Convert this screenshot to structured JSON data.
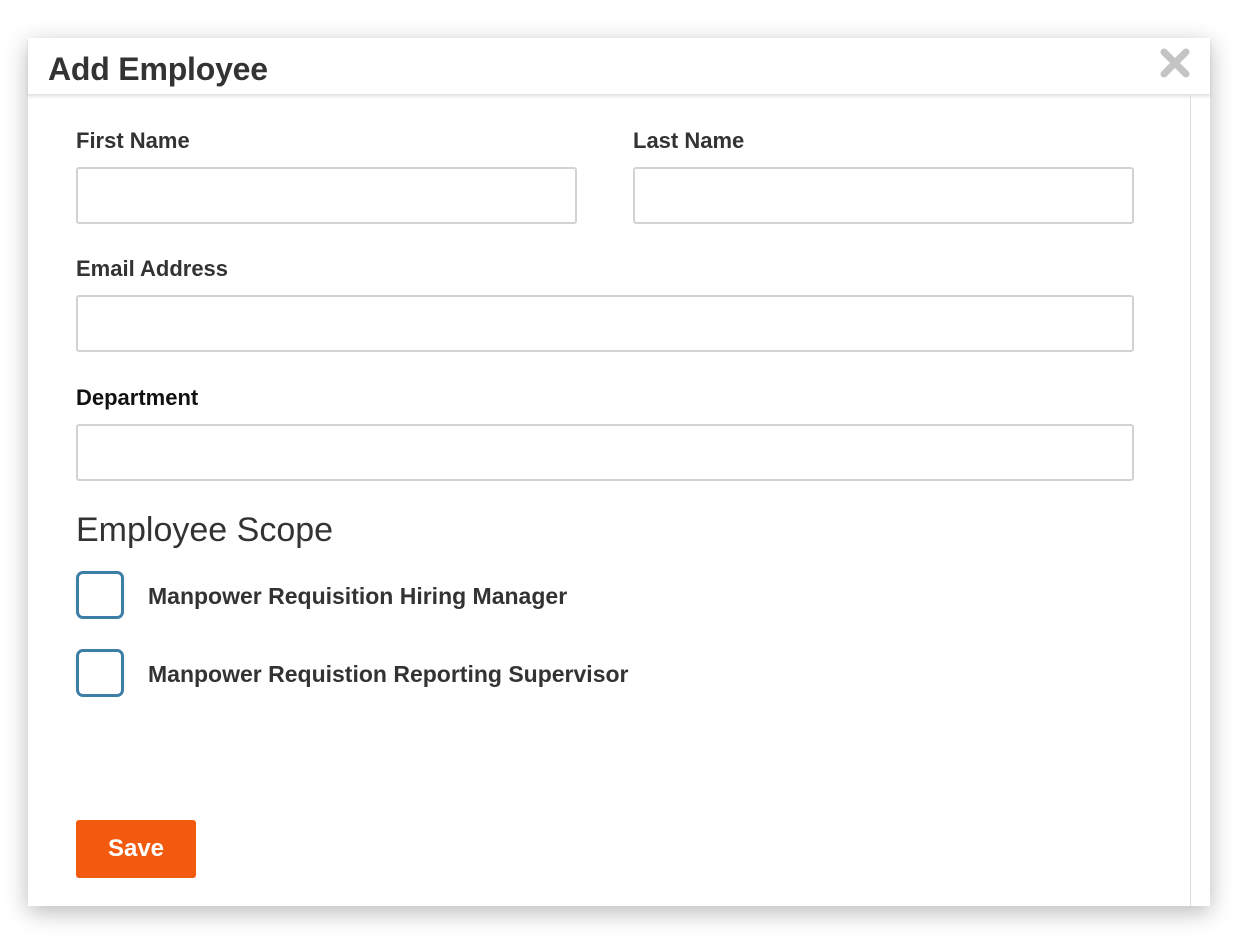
{
  "dialog": {
    "title": "Add Employee",
    "close_icon": "close-icon"
  },
  "form": {
    "first_name": {
      "label": "First Name",
      "value": "",
      "placeholder": ""
    },
    "last_name": {
      "label": "Last Name",
      "value": "",
      "placeholder": ""
    },
    "email": {
      "label": "Email Address",
      "value": "",
      "placeholder": ""
    },
    "department": {
      "label": "Department",
      "value": "",
      "placeholder": ""
    }
  },
  "scope": {
    "heading": "Employee Scope",
    "options": [
      {
        "label": "Manpower Requisition Hiring Manager",
        "checked": false
      },
      {
        "label": "Manpower Requistion Reporting Supervisor",
        "checked": false
      }
    ]
  },
  "actions": {
    "save_label": "Save"
  },
  "colors": {
    "accent": "#f15a0f",
    "checkbox_border": "#3d7ea6",
    "text": "#333333",
    "input_border": "#d3d3d3"
  }
}
